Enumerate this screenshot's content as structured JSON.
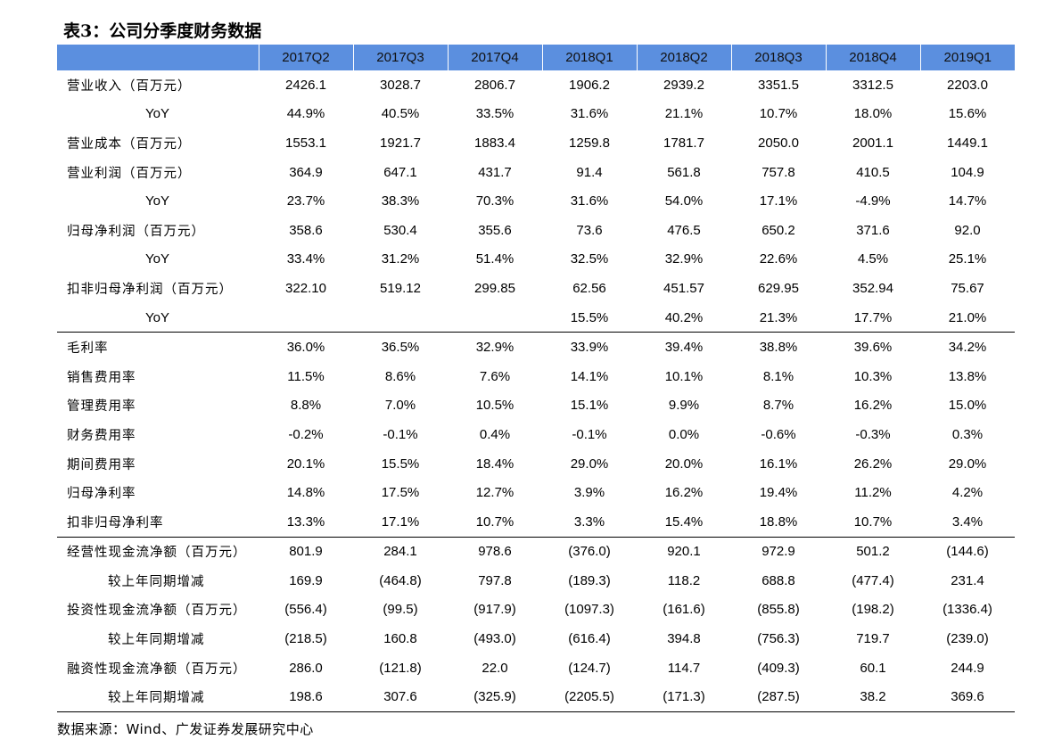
{
  "title": "表3：公司分季度财务数据",
  "columns": [
    "2017Q2",
    "2017Q3",
    "2017Q4",
    "2018Q1",
    "2018Q2",
    "2018Q3",
    "2018Q4",
    "2019Q1"
  ],
  "rows": [
    {
      "label": "营业收入（百万元）",
      "kind": "main",
      "values": [
        "2426.1",
        "3028.7",
        "2806.7",
        "1906.2",
        "2939.2",
        "3351.5",
        "3312.5",
        "2203.0"
      ]
    },
    {
      "label": "YoY",
      "kind": "yoy",
      "values": [
        "44.9%",
        "40.5%",
        "33.5%",
        "31.6%",
        "21.1%",
        "10.7%",
        "18.0%",
        "15.6%"
      ]
    },
    {
      "label": "营业成本（百万元）",
      "kind": "main",
      "values": [
        "1553.1",
        "1921.7",
        "1883.4",
        "1259.8",
        "1781.7",
        "2050.0",
        "2001.1",
        "1449.1"
      ]
    },
    {
      "label": "营业利润（百万元）",
      "kind": "main",
      "values": [
        "364.9",
        "647.1",
        "431.7",
        "91.4",
        "561.8",
        "757.8",
        "410.5",
        "104.9"
      ]
    },
    {
      "label": "YoY",
      "kind": "yoy",
      "values": [
        "23.7%",
        "38.3%",
        "70.3%",
        "31.6%",
        "54.0%",
        "17.1%",
        "-4.9%",
        "14.7%"
      ]
    },
    {
      "label": "归母净利润（百万元）",
      "kind": "main",
      "values": [
        "358.6",
        "530.4",
        "355.6",
        "73.6",
        "476.5",
        "650.2",
        "371.6",
        "92.0"
      ]
    },
    {
      "label": "YoY",
      "kind": "yoy",
      "values": [
        "33.4%",
        "31.2%",
        "51.4%",
        "32.5%",
        "32.9%",
        "22.6%",
        "4.5%",
        "25.1%"
      ]
    },
    {
      "label": "扣非归母净利润（百万元）",
      "kind": "main",
      "values": [
        "322.10",
        "519.12",
        "299.85",
        "62.56",
        "451.57",
        "629.95",
        "352.94",
        "75.67"
      ]
    },
    {
      "label": "YoY",
      "kind": "yoy",
      "values": [
        "",
        "",
        "",
        "15.5%",
        "40.2%",
        "21.3%",
        "17.7%",
        "21.0%"
      ]
    },
    {
      "label": "毛利率",
      "kind": "main",
      "sep": true,
      "values": [
        "36.0%",
        "36.5%",
        "32.9%",
        "33.9%",
        "39.4%",
        "38.8%",
        "39.6%",
        "34.2%"
      ]
    },
    {
      "label": "销售费用率",
      "kind": "main",
      "values": [
        "11.5%",
        "8.6%",
        "7.6%",
        "14.1%",
        "10.1%",
        "8.1%",
        "10.3%",
        "13.8%"
      ]
    },
    {
      "label": "管理费用率",
      "kind": "main",
      "values": [
        "8.8%",
        "7.0%",
        "10.5%",
        "15.1%",
        "9.9%",
        "8.7%",
        "16.2%",
        "15.0%"
      ]
    },
    {
      "label": "财务费用率",
      "kind": "main",
      "values": [
        "-0.2%",
        "-0.1%",
        "0.4%",
        "-0.1%",
        "0.0%",
        "-0.6%",
        "-0.3%",
        "0.3%"
      ]
    },
    {
      "label": "期间费用率",
      "kind": "main",
      "values": [
        "20.1%",
        "15.5%",
        "18.4%",
        "29.0%",
        "20.0%",
        "16.1%",
        "26.2%",
        "29.0%"
      ]
    },
    {
      "label": "归母净利率",
      "kind": "main",
      "values": [
        "14.8%",
        "17.5%",
        "12.7%",
        "3.9%",
        "16.2%",
        "19.4%",
        "11.2%",
        "4.2%"
      ]
    },
    {
      "label": "扣非归母净利率",
      "kind": "main",
      "values": [
        "13.3%",
        "17.1%",
        "10.7%",
        "3.3%",
        "15.4%",
        "18.8%",
        "10.7%",
        "3.4%"
      ]
    },
    {
      "label": "经营性现金流净额（百万元）",
      "kind": "main",
      "sep": true,
      "values": [
        "801.9",
        "284.1",
        "978.6",
        "(376.0)",
        "920.1",
        "972.9",
        "501.2",
        "(144.6)"
      ]
    },
    {
      "label": "较上年同期增减",
      "kind": "chg",
      "values": [
        "169.9",
        "(464.8)",
        "797.8",
        "(189.3)",
        "118.2",
        "688.8",
        "(477.4)",
        "231.4"
      ]
    },
    {
      "label": "投资性现金流净额（百万元）",
      "kind": "main",
      "values": [
        "(556.4)",
        "(99.5)",
        "(917.9)",
        "(1097.3)",
        "(161.6)",
        "(855.8)",
        "(198.2)",
        "(1336.4)"
      ]
    },
    {
      "label": "较上年同期增减",
      "kind": "chg",
      "values": [
        "(218.5)",
        "160.8",
        "(493.0)",
        "(616.4)",
        "394.8",
        "(756.3)",
        "719.7",
        "(239.0)"
      ]
    },
    {
      "label": "融资性现金流净额（百万元）",
      "kind": "main",
      "values": [
        "286.0",
        "(121.8)",
        "22.0",
        "(124.7)",
        "114.7",
        "(409.3)",
        "60.1",
        "244.9"
      ]
    },
    {
      "label": "较上年同期增减",
      "kind": "chg",
      "last": true,
      "values": [
        "198.6",
        "307.6",
        "(325.9)",
        "(2205.5)",
        "(171.3)",
        "(287.5)",
        "38.2",
        "369.6"
      ]
    }
  ],
  "source": "数据来源：Wind、广发证券发展研究中心",
  "colors": {
    "header_bg": "#5b8fdf"
  }
}
